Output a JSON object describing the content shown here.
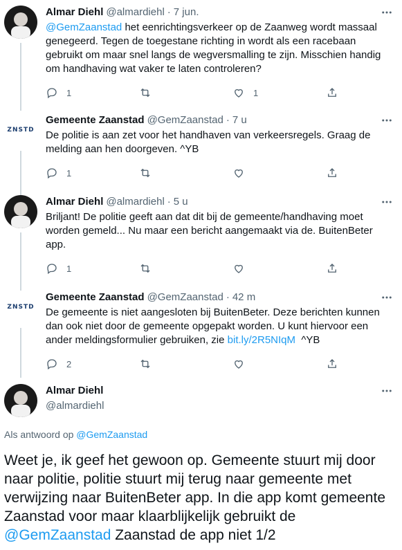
{
  "tweets": [
    {
      "name": "Almar Diehl",
      "handle": "@almardiehl",
      "time": "7 jun.",
      "mention": "@GemZaanstad",
      "text": " het eenrichtingsverkeer op de Zaanweg wordt massaal genegeerd. Tegen de toegestane richting in wordt als een racebaan gebruikt om maar snel langs de wegversmalling te zijn. Misschien handig om handhaving wat vaker te laten controleren?",
      "replies": "1",
      "retweets": "",
      "likes": "1"
    },
    {
      "name": "Gemeente Zaanstad",
      "handle": "@GemZaanstad",
      "time": "7 u",
      "text": "De politie is aan zet voor het handhaven van verkeersregels. Graag de melding aan hen doorgeven. ^YB",
      "replies": "1",
      "retweets": "",
      "likes": ""
    },
    {
      "name": "Almar Diehl",
      "handle": "@almardiehl",
      "time": "5 u",
      "text": "Briljant! De politie geeft aan dat dit bij de gemeente/handhaving moet worden gemeld... Nu maar een bericht aangemaakt via de. BuitenBeter app.",
      "replies": "1",
      "retweets": "",
      "likes": ""
    },
    {
      "name": "Gemeente Zaanstad",
      "handle": "@GemZaanstad",
      "time": "42 m",
      "text": "De gemeente is niet aangesloten bij BuitenBeter. Deze berichten kunnen dan ook niet door de gemeente opgepakt worden. U kunt hiervoor een ander meldingsformulier gebruiken, zie ",
      "link": "bit.ly/2R5NIqM",
      "text_after": "  ^YB",
      "replies": "2",
      "retweets": "",
      "likes": ""
    }
  ],
  "brand_avatar_text": "ZNSTD",
  "main": {
    "name": "Almar Diehl",
    "handle": "@almardiehl",
    "reply_prefix": "Als antwoord op ",
    "reply_to": "@GemZaanstad",
    "text_1": "Weet je, ik geef het gewoon op. Gemeente stuurt mij door naar politie, politie stuurt mij terug naar gemeente met verwijzing naar BuitenBeter app. In die app komt gemeente Zaanstad voor maar klaarblijkelijk gebruikt de ",
    "mention": "@GemZaanstad",
    "text_2": " Zaanstad de app niet 1/2"
  },
  "colors": {
    "accent": "#1d9bf0",
    "muted": "#536471",
    "text": "#0f1419",
    "thread": "#cfd9de"
  }
}
